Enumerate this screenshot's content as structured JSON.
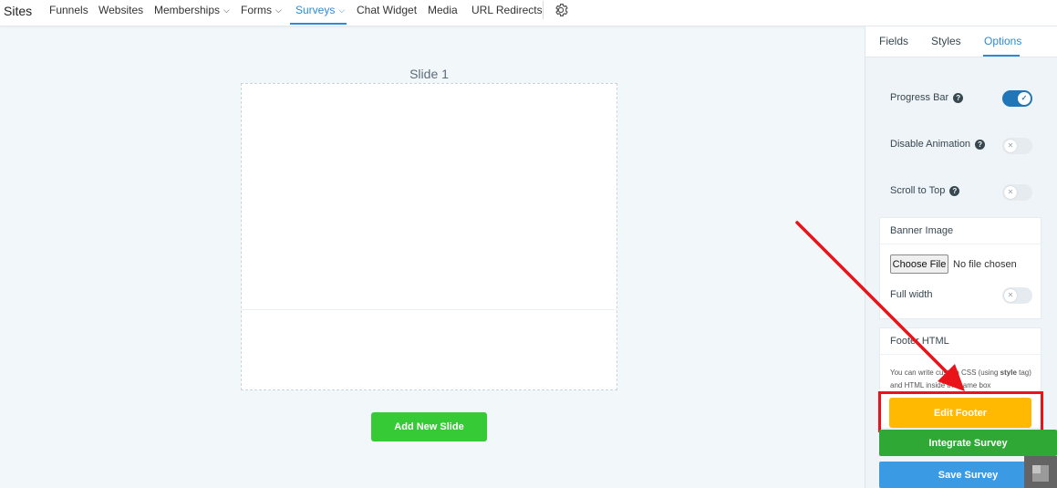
{
  "topnav": {
    "brand": "Sites",
    "items": [
      {
        "label": "Funnels"
      },
      {
        "label": "Websites"
      },
      {
        "label": "Memberships"
      },
      {
        "label": "Forms"
      },
      {
        "label": "Surveys"
      },
      {
        "label": "Chat Widget"
      },
      {
        "label": "Media"
      },
      {
        "label": "URL Redirects"
      }
    ],
    "active": "Surveys",
    "settings_icon": "gear-icon",
    "accent_color": "#2d8bd6"
  },
  "canvas": {
    "slide_title": "Slide 1",
    "add_slide_label": "Add New Slide"
  },
  "panel": {
    "tabs": [
      {
        "label": "Fields"
      },
      {
        "label": "Styles"
      },
      {
        "label": "Options"
      }
    ],
    "active_tab": "Options",
    "options": {
      "progress_bar": {
        "label": "Progress Bar",
        "enabled": true
      },
      "disable_animation": {
        "label": "Disable Animation",
        "enabled": false
      },
      "scroll_to_top": {
        "label": "Scroll to Top",
        "enabled": false
      }
    },
    "banner": {
      "title": "Banner Image",
      "choose_file_label": "Choose File",
      "no_file_text": "No file chosen",
      "full_width_label": "Full width",
      "full_width_enabled": false
    },
    "footer": {
      "title": "Footer HTML",
      "note_before": "You can write custom CSS (using ",
      "note_bold": "style",
      "note_after": " tag) and HTML inside the same box",
      "edit_label": "Edit Footer"
    },
    "integrate_label": "Integrate Survey",
    "save_label": "Save Survey"
  },
  "colors": {
    "edit_footer": "#ffb900",
    "integrate": "#2fa836",
    "save": "#3a9be4",
    "add_slide": "#37ca37",
    "annotation": "#e8141a"
  }
}
